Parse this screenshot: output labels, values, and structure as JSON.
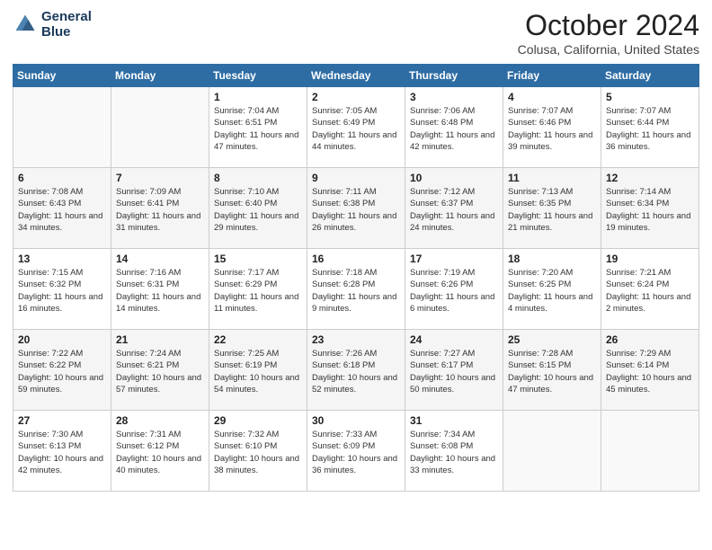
{
  "logo": {
    "line1": "General",
    "line2": "Blue"
  },
  "title": "October 2024",
  "location": "Colusa, California, United States",
  "days_of_week": [
    "Sunday",
    "Monday",
    "Tuesday",
    "Wednesday",
    "Thursday",
    "Friday",
    "Saturday"
  ],
  "weeks": [
    [
      {
        "num": "",
        "info": ""
      },
      {
        "num": "",
        "info": ""
      },
      {
        "num": "1",
        "info": "Sunrise: 7:04 AM\nSunset: 6:51 PM\nDaylight: 11 hours and 47 minutes."
      },
      {
        "num": "2",
        "info": "Sunrise: 7:05 AM\nSunset: 6:49 PM\nDaylight: 11 hours and 44 minutes."
      },
      {
        "num": "3",
        "info": "Sunrise: 7:06 AM\nSunset: 6:48 PM\nDaylight: 11 hours and 42 minutes."
      },
      {
        "num": "4",
        "info": "Sunrise: 7:07 AM\nSunset: 6:46 PM\nDaylight: 11 hours and 39 minutes."
      },
      {
        "num": "5",
        "info": "Sunrise: 7:07 AM\nSunset: 6:44 PM\nDaylight: 11 hours and 36 minutes."
      }
    ],
    [
      {
        "num": "6",
        "info": "Sunrise: 7:08 AM\nSunset: 6:43 PM\nDaylight: 11 hours and 34 minutes."
      },
      {
        "num": "7",
        "info": "Sunrise: 7:09 AM\nSunset: 6:41 PM\nDaylight: 11 hours and 31 minutes."
      },
      {
        "num": "8",
        "info": "Sunrise: 7:10 AM\nSunset: 6:40 PM\nDaylight: 11 hours and 29 minutes."
      },
      {
        "num": "9",
        "info": "Sunrise: 7:11 AM\nSunset: 6:38 PM\nDaylight: 11 hours and 26 minutes."
      },
      {
        "num": "10",
        "info": "Sunrise: 7:12 AM\nSunset: 6:37 PM\nDaylight: 11 hours and 24 minutes."
      },
      {
        "num": "11",
        "info": "Sunrise: 7:13 AM\nSunset: 6:35 PM\nDaylight: 11 hours and 21 minutes."
      },
      {
        "num": "12",
        "info": "Sunrise: 7:14 AM\nSunset: 6:34 PM\nDaylight: 11 hours and 19 minutes."
      }
    ],
    [
      {
        "num": "13",
        "info": "Sunrise: 7:15 AM\nSunset: 6:32 PM\nDaylight: 11 hours and 16 minutes."
      },
      {
        "num": "14",
        "info": "Sunrise: 7:16 AM\nSunset: 6:31 PM\nDaylight: 11 hours and 14 minutes."
      },
      {
        "num": "15",
        "info": "Sunrise: 7:17 AM\nSunset: 6:29 PM\nDaylight: 11 hours and 11 minutes."
      },
      {
        "num": "16",
        "info": "Sunrise: 7:18 AM\nSunset: 6:28 PM\nDaylight: 11 hours and 9 minutes."
      },
      {
        "num": "17",
        "info": "Sunrise: 7:19 AM\nSunset: 6:26 PM\nDaylight: 11 hours and 6 minutes."
      },
      {
        "num": "18",
        "info": "Sunrise: 7:20 AM\nSunset: 6:25 PM\nDaylight: 11 hours and 4 minutes."
      },
      {
        "num": "19",
        "info": "Sunrise: 7:21 AM\nSunset: 6:24 PM\nDaylight: 11 hours and 2 minutes."
      }
    ],
    [
      {
        "num": "20",
        "info": "Sunrise: 7:22 AM\nSunset: 6:22 PM\nDaylight: 10 hours and 59 minutes."
      },
      {
        "num": "21",
        "info": "Sunrise: 7:24 AM\nSunset: 6:21 PM\nDaylight: 10 hours and 57 minutes."
      },
      {
        "num": "22",
        "info": "Sunrise: 7:25 AM\nSunset: 6:19 PM\nDaylight: 10 hours and 54 minutes."
      },
      {
        "num": "23",
        "info": "Sunrise: 7:26 AM\nSunset: 6:18 PM\nDaylight: 10 hours and 52 minutes."
      },
      {
        "num": "24",
        "info": "Sunrise: 7:27 AM\nSunset: 6:17 PM\nDaylight: 10 hours and 50 minutes."
      },
      {
        "num": "25",
        "info": "Sunrise: 7:28 AM\nSunset: 6:15 PM\nDaylight: 10 hours and 47 minutes."
      },
      {
        "num": "26",
        "info": "Sunrise: 7:29 AM\nSunset: 6:14 PM\nDaylight: 10 hours and 45 minutes."
      }
    ],
    [
      {
        "num": "27",
        "info": "Sunrise: 7:30 AM\nSunset: 6:13 PM\nDaylight: 10 hours and 42 minutes."
      },
      {
        "num": "28",
        "info": "Sunrise: 7:31 AM\nSunset: 6:12 PM\nDaylight: 10 hours and 40 minutes."
      },
      {
        "num": "29",
        "info": "Sunrise: 7:32 AM\nSunset: 6:10 PM\nDaylight: 10 hours and 38 minutes."
      },
      {
        "num": "30",
        "info": "Sunrise: 7:33 AM\nSunset: 6:09 PM\nDaylight: 10 hours and 36 minutes."
      },
      {
        "num": "31",
        "info": "Sunrise: 7:34 AM\nSunset: 6:08 PM\nDaylight: 10 hours and 33 minutes."
      },
      {
        "num": "",
        "info": ""
      },
      {
        "num": "",
        "info": ""
      }
    ]
  ]
}
